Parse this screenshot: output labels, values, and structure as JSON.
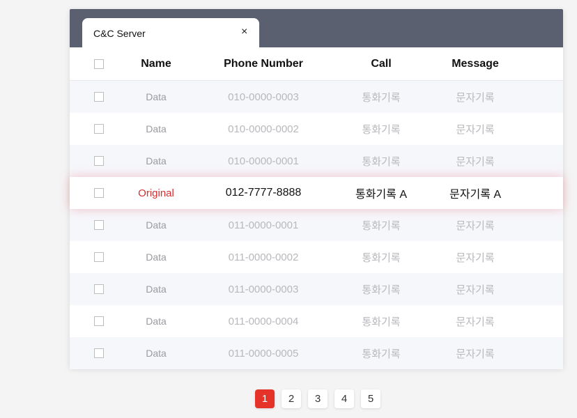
{
  "tab": {
    "label": "C&C Server",
    "close": "×"
  },
  "headers": {
    "name": "Name",
    "phone": "Phone Number",
    "call": "Call",
    "message": "Message"
  },
  "rows": [
    {
      "name": "Data",
      "phone": "010-0000-0003",
      "call": "통화기록",
      "message": "문자기록"
    },
    {
      "name": "Data",
      "phone": "010-0000-0002",
      "call": "통화기록",
      "message": "문자기록"
    },
    {
      "name": "Data",
      "phone": "010-0000-0001",
      "call": "통화기록",
      "message": "문자기록"
    },
    {
      "name": "Original",
      "phone": "012-7777-8888",
      "call": "통화기록 A",
      "message": "문자기록 A"
    },
    {
      "name": "Data",
      "phone": "011-0000-0001",
      "call": "통화기록",
      "message": "문자기록"
    },
    {
      "name": "Data",
      "phone": "011-0000-0002",
      "call": "통화기록",
      "message": "문자기록"
    },
    {
      "name": "Data",
      "phone": "011-0000-0003",
      "call": "통화기록",
      "message": "문자기록"
    },
    {
      "name": "Data",
      "phone": "011-0000-0004",
      "call": "통화기록",
      "message": "문자기록"
    },
    {
      "name": "Data",
      "phone": "011-0000-0005",
      "call": "통화기록",
      "message": "문자기록"
    }
  ],
  "pagination": {
    "pages": [
      "1",
      "2",
      "3",
      "4",
      "5"
    ],
    "current": "1"
  },
  "colors": {
    "titlebar": "#5b6071",
    "accent": "#e5332a",
    "highlight_name": "#d32f2f"
  }
}
